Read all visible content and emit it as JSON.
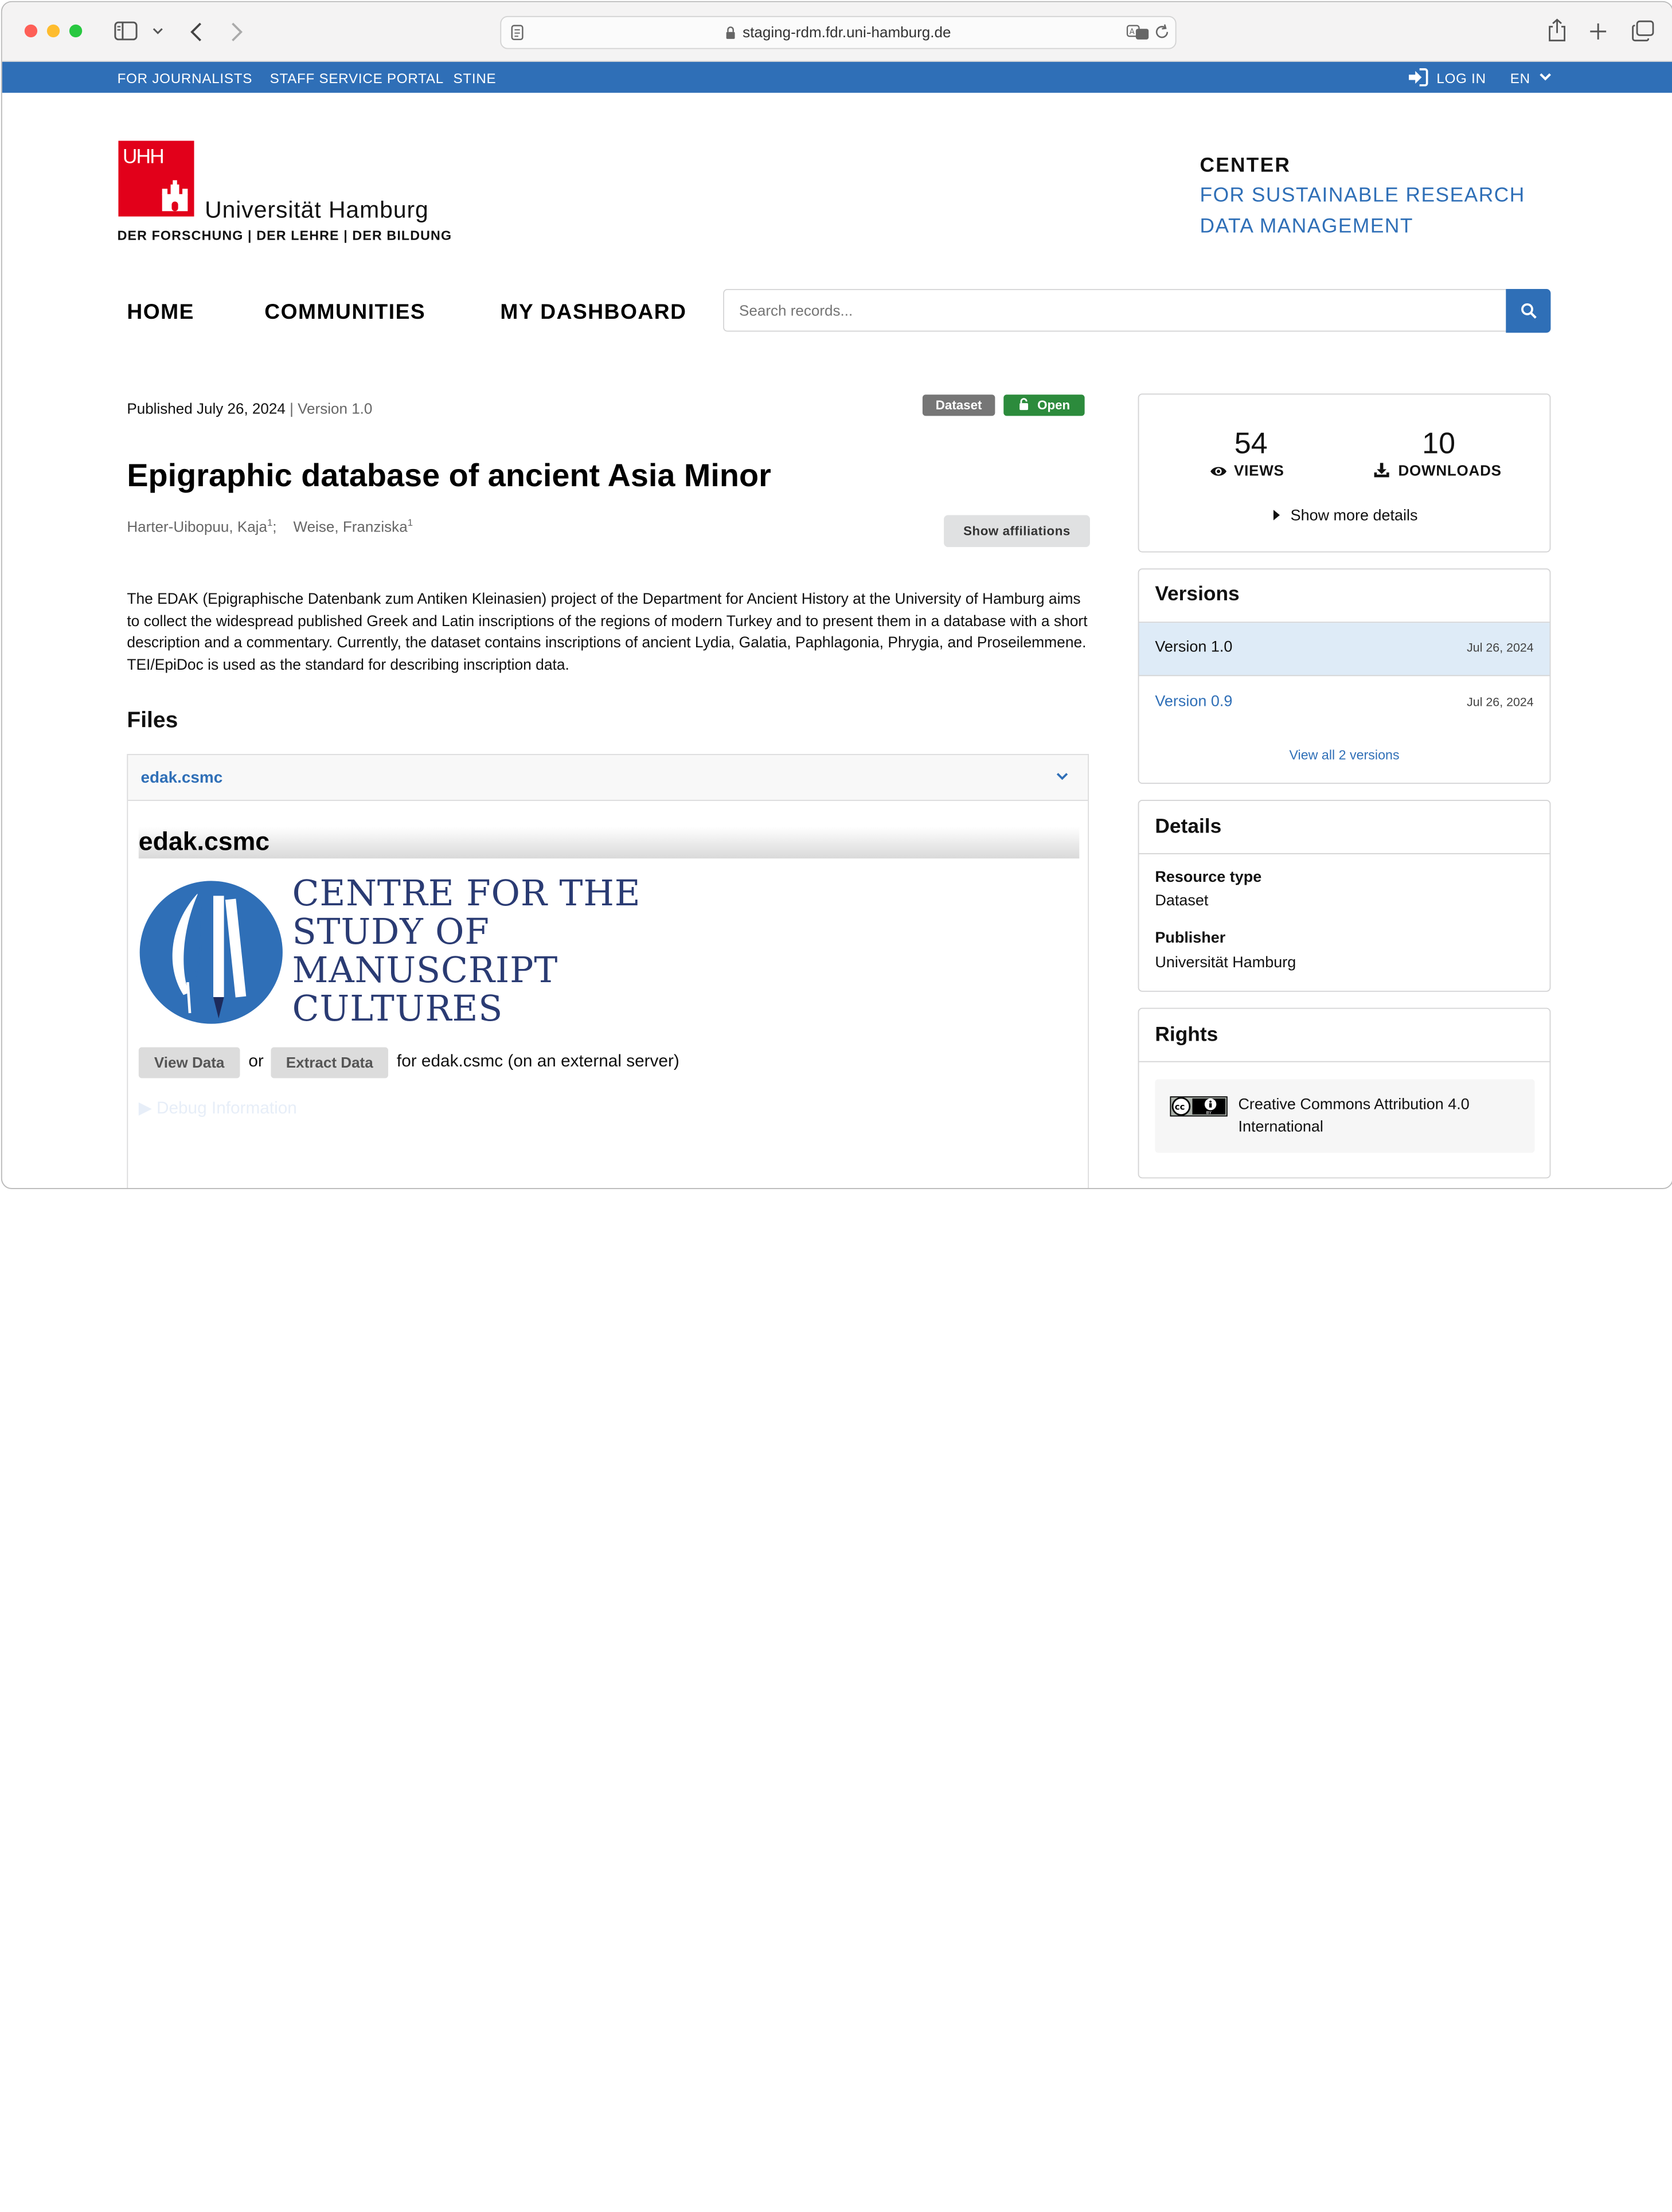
{
  "browser": {
    "url": "staging-rdm.fdr.uni-hamburg.de"
  },
  "topbar": {
    "links": [
      "FOR JOURNALISTS",
      "STAFF SERVICE PORTAL",
      "STINE"
    ],
    "login": "LOG IN",
    "language": "EN"
  },
  "header": {
    "logo_mark": "UHH",
    "university": "Universität Hamburg",
    "tagline": "DER FORSCHUNG | DER LEHRE | DER BILDUNG",
    "center_line1": "CENTER",
    "center_line2": "FOR SUSTAINABLE RESEARCH",
    "center_line3": "DATA MANAGEMENT"
  },
  "nav": {
    "items": [
      "HOME",
      "COMMUNITIES",
      "MY DASHBOARD"
    ],
    "search_placeholder": "Search records..."
  },
  "record": {
    "published": "Published July 26, 2024",
    "version": "Version 1.0",
    "badge_type": "Dataset",
    "badge_access": "Open",
    "title": "Epigraphic database of ancient Asia Minor",
    "authors": [
      {
        "name": "Harter-Uibopuu, Kaja",
        "sup": "1"
      },
      {
        "name": "Weise, Franziska",
        "sup": "1"
      }
    ],
    "show_affiliations": "Show affiliations",
    "description": "The EDAK (Epigraphische Datenbank zum Antiken Kleinasien) project of the Department for Ancient History at the University of Hamburg aims to collect the widespread published Greek and Latin inscriptions of the regions of modern Turkey and to present them in a database with a short description and a commentary. Currently, the dataset contains inscriptions of ancient Lydia, Galatia, Paphlagonia, Phrygia, and Proseilemmene. TEI/EpiDoc is used as the standard for describing inscription data."
  },
  "files": {
    "heading": "Files",
    "file_name": "edak.csmc",
    "preview_title": "edak.csmc",
    "csmc_lines": [
      "CENTRE FOR THE",
      "STUDY OF",
      "MANUSCRIPT",
      "CULTURES"
    ],
    "view_data": "View Data",
    "or": "or",
    "extract_data": "Extract Data",
    "for_text": "for edak.csmc (on an external server)",
    "debug": "Debug Information"
  },
  "stats": {
    "views_count": "54",
    "views_label": "VIEWS",
    "downloads_count": "10",
    "downloads_label": "DOWNLOADS",
    "more": "Show more details"
  },
  "versions": {
    "heading": "Versions",
    "items": [
      {
        "label": "Version 1.0",
        "date": "Jul 26, 2024"
      },
      {
        "label": "Version 0.9",
        "date": "Jul 26, 2024"
      }
    ],
    "view_all": "View all 2 versions"
  },
  "details": {
    "heading": "Details",
    "resource_type_label": "Resource type",
    "resource_type": "Dataset",
    "publisher_label": "Publisher",
    "publisher": "Universität Hamburg"
  },
  "rights": {
    "heading": "Rights",
    "license_line1": "Creative Commons Attribution 4.0",
    "license_line2": "International"
  }
}
